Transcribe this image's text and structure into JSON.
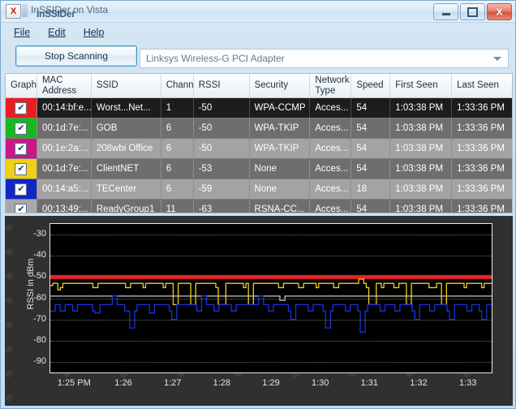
{
  "window": {
    "title": "InSSIDer on Vista",
    "title_overlay": "InSSIDer",
    "app_icon": "x-icon",
    "minimize_label": "–",
    "maximize_label": "□",
    "close_label": "X"
  },
  "menu": {
    "items": [
      {
        "label": "File",
        "accel": "F"
      },
      {
        "label": "Edit",
        "accel": "E"
      },
      {
        "label": "Help",
        "accel": "H"
      }
    ]
  },
  "toolbar": {
    "scan_button": "Stop Scanning",
    "adapter_selected": "Linksys Wireless-G PCI Adapter",
    "adapter_arrow": "chevron-down-icon"
  },
  "table": {
    "columns": [
      "Graph",
      "MAC\nAddress",
      "SSID",
      "Chann",
      "RSSI",
      "Security",
      "Network\nType",
      "Speed",
      "First Seen",
      "Last Seen"
    ],
    "columns_flat": {
      "graph": "Graph",
      "mac_line1": "MAC",
      "mac_line2": "Address",
      "ssid": "SSID",
      "channel": "Chann",
      "rssi": "RSSI",
      "security": "Security",
      "ntype_line1": "Network",
      "ntype_line2": "Type",
      "speed": "Speed",
      "first_seen": "First Seen",
      "last_seen": "Last Seen"
    },
    "checkbox_glyph": "✔",
    "rows": [
      {
        "color": "#ee1c20",
        "checked": true,
        "selected": true,
        "mac": "00:14:bf:e...",
        "ssid": "Worst...Net...",
        "channel": "1",
        "rssi": "-50",
        "security": "WPA-CCMP",
        "ntype": "Acces...",
        "speed": "54",
        "first": "1:03:38 PM",
        "last": "1:33:36 PM"
      },
      {
        "color": "#17b81b",
        "checked": true,
        "selected": false,
        "mac": "00:1d:7e:...",
        "ssid": "GOB",
        "channel": "6",
        "rssi": "-50",
        "security": "WPA-TKIP",
        "ntype": "Acces...",
        "speed": "54",
        "first": "1:03:38 PM",
        "last": "1:33:36 PM"
      },
      {
        "color": "#cc1687",
        "checked": true,
        "selected": false,
        "mac": "00:1e:2a:...",
        "ssid": "208wbi Office",
        "channel": "6",
        "rssi": "-50",
        "security": "WPA-TKIP",
        "ntype": "Acces...",
        "speed": "54",
        "first": "1:03:38 PM",
        "last": "1:33:36 PM"
      },
      {
        "color": "#f0cf16",
        "checked": true,
        "selected": false,
        "mac": "00:1d:7e:...",
        "ssid": "ClientNET",
        "channel": "6",
        "rssi": "-53",
        "security": "None",
        "ntype": "Acces...",
        "speed": "54",
        "first": "1:03:38 PM",
        "last": "1:33:36 PM"
      },
      {
        "color": "#1126c6",
        "checked": true,
        "selected": false,
        "mac": "00:14:a5:...",
        "ssid": "TECenter",
        "channel": "6",
        "rssi": "-59",
        "security": "None",
        "ntype": "Acces...",
        "speed": "18",
        "first": "1:03:38 PM",
        "last": "1:33:36 PM"
      },
      {
        "color": "#a8a8a8",
        "checked": true,
        "selected": false,
        "mac": "00:13:49:...",
        "ssid": "ReadyGroup1",
        "channel": "11",
        "rssi": "-63",
        "security": "RSNA-CC...",
        "ntype": "Acces...",
        "speed": "54",
        "first": "1:03:38 PM",
        "last": "1:33:36 PM"
      }
    ]
  },
  "chart_data": {
    "type": "line",
    "title": "",
    "xlabel": "",
    "ylabel": "RSSI in dBm",
    "ylim": [
      -95,
      -25
    ],
    "yticks": [
      -30,
      -40,
      -50,
      -60,
      -70,
      -80,
      -90
    ],
    "ytick_labels": [
      "-30",
      "-40",
      "-50",
      "-60",
      "-70",
      "-80",
      "-90"
    ],
    "xtick_labels": [
      "1:25 PM",
      "1:26",
      "1:27",
      "1:28",
      "1:29",
      "1:30",
      "1:31",
      "1:32",
      "1:33"
    ],
    "grid": true,
    "legend": "none",
    "background": "#000000",
    "series": [
      {
        "name": "Worst...Net...",
        "color": "#ee1c20",
        "values": [
          -50,
          -50,
          -50,
          -50,
          -50,
          -50,
          -50,
          -50,
          -50,
          -50,
          -50,
          -50,
          -50,
          -50,
          -50,
          -50,
          -50,
          -50,
          -50,
          -50,
          -50,
          -50,
          -50,
          -50,
          -50,
          -50,
          -50,
          -50,
          -50,
          -50,
          -50,
          -50,
          -50,
          -50,
          -50,
          -50,
          -50,
          -50,
          -50,
          -50,
          -50,
          -50,
          -50,
          -50,
          -50,
          -50,
          -50,
          -50,
          -50,
          -50,
          -50,
          -50,
          -50,
          -50,
          -50,
          -50,
          -50,
          -50,
          -50,
          -50,
          -50,
          -50,
          -50,
          -50,
          -50,
          -50,
          -50,
          -50,
          -50,
          -50,
          -50,
          -50,
          -50,
          -50,
          -50,
          -50,
          -50,
          -50,
          -50,
          -50,
          -50,
          -50,
          -50,
          -50,
          -50,
          -50,
          -50,
          -50,
          -50,
          -50,
          -50,
          -50,
          -50,
          -50,
          -50,
          -50,
          -50,
          -50,
          -50,
          -50,
          -50,
          -50,
          -50,
          -50,
          -50,
          -50,
          -50,
          -50,
          -50,
          -50,
          -50,
          -50,
          -50,
          -50,
          -50,
          -50,
          -50,
          -50,
          -50,
          -50,
          -50,
          -50,
          -50,
          -50,
          -50,
          -50,
          -50,
          -50,
          -50,
          -50,
          -50,
          -50,
          -50,
          -50,
          -50,
          -50,
          -50,
          -50,
          -50,
          -50,
          -50,
          -50,
          -50,
          -50,
          -50,
          -50,
          -50,
          -50,
          -50,
          -50,
          -50,
          -50,
          -50,
          -50,
          -50,
          -50,
          -50,
          -50,
          -50,
          -50,
          -50,
          -50,
          -50,
          -50,
          -50,
          -50,
          -50,
          -50,
          -50,
          -50,
          -50,
          -50,
          -50,
          -50,
          -50,
          -50,
          -50,
          -50,
          -50,
          -50,
          -50
        ]
      },
      {
        "name": "ClientNET",
        "color": "#f0cf16",
        "values": [
          -54,
          -53,
          -53,
          -56,
          -55,
          -53,
          -53,
          -53,
          -53,
          -53,
          -53,
          -53,
          -53,
          -53,
          -53,
          -53,
          -53,
          -55,
          -55,
          -53,
          -53,
          -53,
          -53,
          -53,
          -53,
          -53,
          -53,
          -53,
          -53,
          -53,
          -55,
          -55,
          -53,
          -53,
          -53,
          -53,
          -53,
          -55,
          -53,
          -53,
          -53,
          -53,
          -53,
          -53,
          -53,
          -55,
          -53,
          -53,
          -53,
          -63,
          -63,
          -53,
          -53,
          -53,
          -53,
          -53,
          -63,
          -63,
          -53,
          -53,
          -53,
          -53,
          -53,
          -53,
          -53,
          -53,
          -55,
          -63,
          -63,
          -63,
          -53,
          -53,
          -53,
          -53,
          -53,
          -53,
          -53,
          -55,
          -53,
          -63,
          -63,
          -53,
          -53,
          -53,
          -53,
          -53,
          -53,
          -53,
          -53,
          -53,
          -53,
          -55,
          -55,
          -53,
          -53,
          -53,
          -53,
          -53,
          -53,
          -55,
          -55,
          -53,
          -53,
          -53,
          -53,
          -53,
          -55,
          -53,
          -53,
          -53,
          -53,
          -53,
          -53,
          -55,
          -55,
          -53,
          -53,
          -53,
          -53,
          -53,
          -53,
          -53,
          -53,
          -51,
          -51,
          -53,
          -55,
          -63,
          -63,
          -63,
          -53,
          -53,
          -55,
          -53,
          -53,
          -53,
          -53,
          -55,
          -55,
          -53,
          -53,
          -53,
          -63,
          -63,
          -53,
          -53,
          -53,
          -53,
          -53,
          -53,
          -53,
          -55,
          -55,
          -55,
          -53,
          -53,
          -63,
          -63,
          -53,
          -53,
          -53,
          -53,
          -53,
          -53,
          -53,
          -55,
          -53,
          -53,
          -53,
          -53,
          -53,
          -53,
          -55,
          -53,
          -53,
          -53
        ]
      },
      {
        "name": "TECenter",
        "color": "#c9c9c9",
        "values": [
          -59,
          -59,
          -59,
          -59,
          -59,
          -59,
          -59,
          -59,
          -59,
          -59,
          -59,
          -59,
          -59,
          -59,
          -59,
          -59,
          -59,
          -59,
          -59,
          -59,
          -59,
          -59,
          -59,
          -59,
          -59,
          -59,
          -59,
          -59,
          -59,
          -59,
          -59,
          -59,
          -59,
          -59,
          -59,
          -59,
          -59,
          -59,
          -59,
          -59,
          -59,
          -59,
          -59,
          -59,
          -59,
          -59,
          -59,
          -59,
          -59,
          -59,
          -59,
          -59,
          -59,
          -59,
          -59,
          -59,
          -59,
          -59,
          -59,
          -59,
          -59,
          -59,
          -59,
          -59,
          -59,
          -59,
          -59,
          -59,
          -59,
          -59,
          -59,
          -59,
          -59,
          -59,
          -59,
          -59,
          -59,
          -59,
          -59,
          -59,
          -59,
          -59,
          -59,
          -59,
          -59,
          -59,
          -59,
          -59,
          -59,
          -59,
          -61,
          -61,
          -59,
          -59,
          -59,
          -59,
          -59,
          -59,
          -59,
          -59,
          -59,
          -59,
          -59,
          -59,
          -59,
          -59,
          -59,
          -59,
          -59,
          -59,
          -59,
          -59,
          -59,
          -59,
          -59,
          -59,
          -59,
          -59,
          -59,
          -59,
          -59,
          -59,
          -59,
          -59,
          -59,
          -59,
          -59,
          -59,
          -59,
          -59,
          -59,
          -59,
          -59,
          -59,
          -59,
          -59,
          -59,
          -59,
          -59,
          -59,
          -59,
          -59,
          -59,
          -59,
          -59,
          -59,
          -59,
          -59,
          -59,
          -59,
          -59,
          -59,
          -59,
          -59,
          -59,
          -59,
          -59,
          -59,
          -59,
          -59,
          -59,
          -59,
          -59,
          -59,
          -59,
          -59,
          -59,
          -59,
          -59,
          -59,
          -59,
          -59,
          -59
        ]
      },
      {
        "name": "ReadyGroup1",
        "color": "#1a33dd",
        "values": [
          -66,
          -66,
          -63,
          -63,
          -66,
          -66,
          -63,
          -63,
          -63,
          -66,
          -66,
          -63,
          -63,
          -63,
          -63,
          -63,
          -63,
          -66,
          -67,
          -67,
          -63,
          -63,
          -63,
          -63,
          -63,
          -59,
          -59,
          -63,
          -63,
          -63,
          -66,
          -66,
          -74,
          -74,
          -66,
          -63,
          -63,
          -63,
          -63,
          -63,
          -67,
          -67,
          -63,
          -63,
          -63,
          -63,
          -63,
          -63,
          -66,
          -70,
          -70,
          -63,
          -63,
          -63,
          -63,
          -63,
          -63,
          -63,
          -63,
          -66,
          -66,
          -59,
          -59,
          -63,
          -63,
          -63,
          -66,
          -66,
          -63,
          -63,
          -63,
          -63,
          -63,
          -66,
          -66,
          -63,
          -63,
          -63,
          -63,
          -63,
          -63,
          -63,
          -63,
          -63,
          -59,
          -59,
          -63,
          -63,
          -66,
          -66,
          -63,
          -63,
          -63,
          -63,
          -63,
          -63,
          -66,
          -70,
          -70,
          -63,
          -63,
          -63,
          -63,
          -63,
          -66,
          -66,
          -63,
          -63,
          -63,
          -63,
          -66,
          -74,
          -74,
          -66,
          -63,
          -63,
          -63,
          -63,
          -63,
          -66,
          -66,
          -63,
          -63,
          -63,
          -66,
          -76,
          -76,
          -66,
          -63,
          -63,
          -63,
          -63,
          -63,
          -66,
          -66,
          -63,
          -63,
          -63,
          -63,
          -66,
          -66,
          -63,
          -63,
          -63,
          -63,
          -63,
          -66,
          -70,
          -70,
          -63,
          -63,
          -63,
          -63,
          -66,
          -66,
          -63,
          -63,
          -63,
          -63,
          -63,
          -66,
          -70,
          -70,
          -63,
          -63,
          -63,
          -63,
          -63,
          -66,
          -66,
          -63,
          -63,
          -63,
          -66,
          -70,
          -70,
          -63,
          -63
        ]
      }
    ]
  }
}
